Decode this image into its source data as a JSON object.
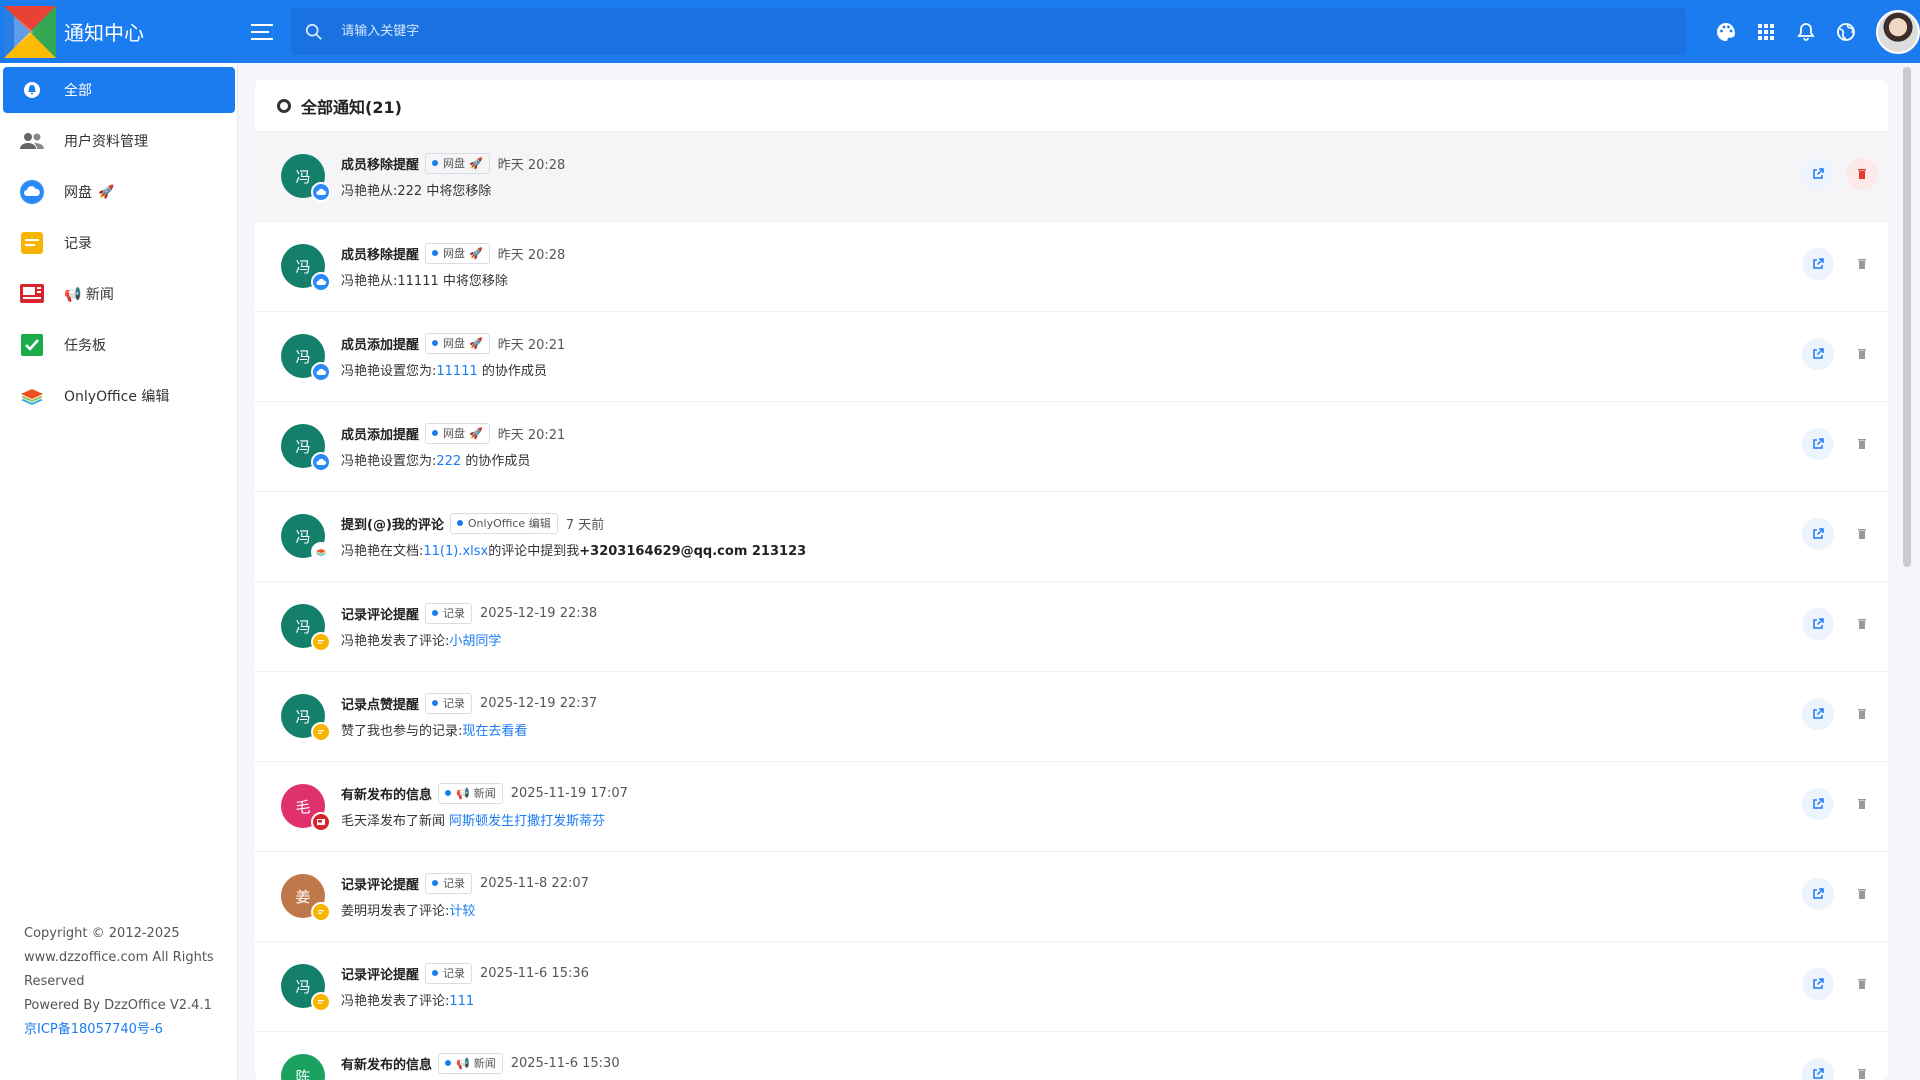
{
  "app": {
    "title": "通知中心"
  },
  "search": {
    "placeholder": "请输入关键字"
  },
  "top_icons": [
    "palette-icon",
    "apps-grid-icon",
    "bell-icon",
    "globe-icon"
  ],
  "sidebar": {
    "items": [
      {
        "label": "全部",
        "icon": "bell-circle-icon",
        "active": true
      },
      {
        "label": "用户资料管理",
        "icon": "users-icon"
      },
      {
        "label": "网盘",
        "icon": "cloud-icon",
        "suffix": "🚀"
      },
      {
        "label": "记录",
        "icon": "note-icon"
      },
      {
        "label": "新闻",
        "icon": "news-icon",
        "prefix": "📢"
      },
      {
        "label": "任务板",
        "icon": "check-icon"
      },
      {
        "label": "OnlyOffice 编辑",
        "icon": "layers-icon"
      }
    ]
  },
  "footer": {
    "copyright": "Copyright © 2012-2025 www.dzzoffice.com All Rights Reserved",
    "powered": "Powered By DzzOffice V2.4.1",
    "icp": "京ICP备18057740号-6"
  },
  "main": {
    "title": "全部通知(21)",
    "notices": [
      {
        "avatar": "冯",
        "color": "#14806b",
        "badge": "cloud",
        "title": "成员移除提醒",
        "app": "网盘",
        "app_emoji": "🚀",
        "time": "昨天 20:28",
        "text": "冯艳艳从:222  中将您移除",
        "highlight": true
      },
      {
        "avatar": "冯",
        "color": "#14806b",
        "badge": "cloud",
        "title": "成员移除提醒",
        "app": "网盘",
        "app_emoji": "🚀",
        "time": "昨天 20:28",
        "text": "冯艳艳从:11111  中将您移除"
      },
      {
        "avatar": "冯",
        "color": "#14806b",
        "badge": "cloud",
        "title": "成员添加提醒",
        "app": "网盘",
        "app_emoji": "🚀",
        "time": "昨天 20:21",
        "text_pre": "冯艳艳设置您为:",
        "link": "11111",
        "text_post": "  的协作成员"
      },
      {
        "avatar": "冯",
        "color": "#14806b",
        "badge": "cloud",
        "title": "成员添加提醒",
        "app": "网盘",
        "app_emoji": "🚀",
        "time": "昨天 20:21",
        "text_pre": "冯艳艳设置您为:",
        "link": "222",
        "text_post": "  的协作成员"
      },
      {
        "avatar": "冯",
        "color": "#14806b",
        "badge": "layers",
        "title": "提到(@)我的评论",
        "app": "OnlyOffice 编辑",
        "time": "7 天前",
        "text_pre": "冯艳艳在文档:",
        "link": "11(1).xlsx",
        "text_post": "的评论中提到我",
        "bold": "+3203164629@qq.com 213123"
      },
      {
        "avatar": "冯",
        "color": "#14806b",
        "badge": "note",
        "title": "记录评论提醒",
        "app": "记录",
        "time": "2025-12-19 22:38",
        "text_pre": "冯艳艳发表了评论:",
        "link": "小胡同学"
      },
      {
        "avatar": "冯",
        "color": "#14806b",
        "badge": "note",
        "title": "记录点赞提醒",
        "app": "记录",
        "time": "2025-12-19 22:37",
        "text_pre": "赞了我也参与的记录:",
        "link": "现在去看看"
      },
      {
        "avatar": "毛",
        "color": "#e0316f",
        "badge": "news",
        "title": "有新发布的信息",
        "app": "新闻",
        "app_prefix": "📢",
        "time": "2025-11-19 17:07",
        "text_pre": "毛天泽发布了新闻 ",
        "link": "阿斯顿发生打撒打发斯蒂芬"
      },
      {
        "avatar": "姜",
        "color": "#c0784a",
        "badge": "note",
        "title": "记录评论提醒",
        "app": "记录",
        "time": "2025-11-8 22:07",
        "text_pre": "姜明玥发表了评论:",
        "link": "计较"
      },
      {
        "avatar": "冯",
        "color": "#14806b",
        "badge": "note",
        "title": "记录评论提醒",
        "app": "记录",
        "time": "2025-11-6 15:36",
        "text_pre": "冯艳艳发表了评论:",
        "link": "111"
      },
      {
        "avatar": "陈",
        "color": "#1aa260",
        "badge": "news",
        "title": "有新发布的信息",
        "app": "新闻",
        "app_prefix": "📢",
        "time": "2025-11-6 15:30",
        "text_pre": ""
      }
    ]
  },
  "colors": {
    "primary": "#1b7cf0",
    "danger": "#e53935"
  }
}
